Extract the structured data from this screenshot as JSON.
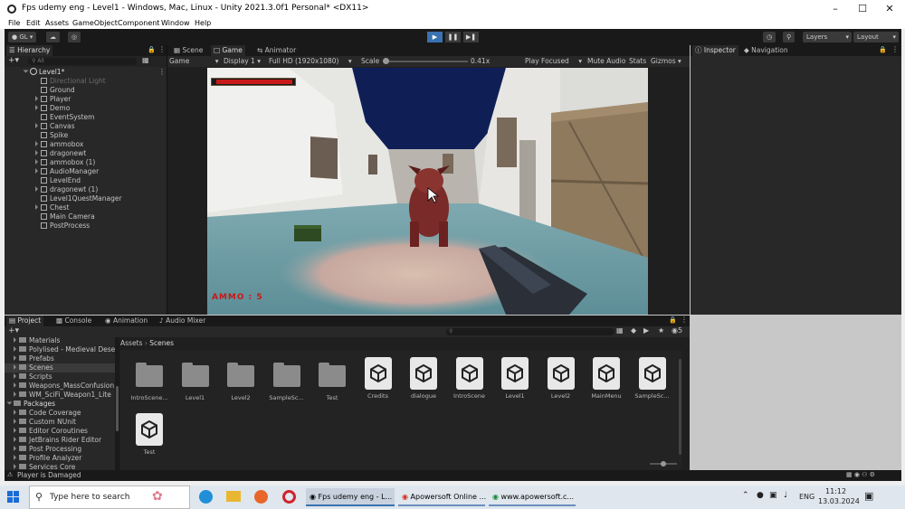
{
  "window": {
    "title": "Fps udemy eng - Level1 - Windows, Mac, Linux - Unity 2021.3.0f1 Personal* <DX11>"
  },
  "menu": [
    "File",
    "Edit",
    "Assets",
    "GameObject",
    "Component",
    "Window",
    "Help"
  ],
  "toolbar": {
    "account": "GL",
    "layers": "Layers",
    "layout": "Layout"
  },
  "hierarchy": {
    "tab": "Hierarchy",
    "search_placeholder": "All",
    "scene": "Level1*",
    "items": [
      {
        "label": "Directional Light",
        "dim": true,
        "arrow": false
      },
      {
        "label": "Ground",
        "arrow": false
      },
      {
        "label": "Player",
        "arrow": true
      },
      {
        "label": "Demo",
        "arrow": true
      },
      {
        "label": "EventSystem",
        "arrow": false
      },
      {
        "label": "Canvas",
        "arrow": true
      },
      {
        "label": "Spike",
        "arrow": false
      },
      {
        "label": "ammobox",
        "arrow": true
      },
      {
        "label": "dragonewt",
        "arrow": true
      },
      {
        "label": "ammobox (1)",
        "arrow": true
      },
      {
        "label": "AudioManager",
        "arrow": true
      },
      {
        "label": "LevelEnd",
        "arrow": false
      },
      {
        "label": "dragonewt (1)",
        "arrow": true
      },
      {
        "label": "Level1QuestManager",
        "arrow": false
      },
      {
        "label": "Chest",
        "arrow": true
      },
      {
        "label": "Main Camera",
        "arrow": false
      },
      {
        "label": "PostProcess",
        "arrow": false
      }
    ]
  },
  "center_tabs": {
    "scene": "Scene",
    "game": "Game",
    "animator": "Animator"
  },
  "game_bar": {
    "mode": "Game",
    "display": "Display 1",
    "resolution": "Full HD (1920x1080)",
    "scale_label": "Scale",
    "scale_value": "0.41x",
    "play_focused": "Play Focused",
    "mute": "Mute Audio",
    "stats": "Stats",
    "gizmos": "Gizmos"
  },
  "game_view": {
    "hud_text": "AMMO : 5",
    "health": 1.0
  },
  "right_tabs": {
    "inspector": "Inspector",
    "navigation": "Navigation"
  },
  "bottom_tabs": {
    "project": "Project",
    "console": "Console",
    "animation": "Animation",
    "audio_mixer": "Audio Mixer"
  },
  "project_tree": [
    {
      "label": "Materials",
      "indent": 1
    },
    {
      "label": "Polylised - Medieval Dese",
      "indent": 1
    },
    {
      "label": "Prefabs",
      "indent": 1
    },
    {
      "label": "Scenes",
      "indent": 1,
      "selected": true
    },
    {
      "label": "Scripts",
      "indent": 1
    },
    {
      "label": "Weapons_MassConfusion",
      "indent": 1
    },
    {
      "label": "WM_SciFi_Weapon1_Lite",
      "indent": 1
    },
    {
      "label": "Packages",
      "indent": 0,
      "bold": true
    },
    {
      "label": "Code Coverage",
      "indent": 1
    },
    {
      "label": "Custom NUnit",
      "indent": 1
    },
    {
      "label": "Editor Coroutines",
      "indent": 1
    },
    {
      "label": "JetBrains Rider Editor",
      "indent": 1
    },
    {
      "label": "Post Processing",
      "indent": 1
    },
    {
      "label": "Profile Analyzer",
      "indent": 1
    },
    {
      "label": "Services Core",
      "indent": 1
    }
  ],
  "breadcrumb": {
    "root": "Assets",
    "current": "Scenes"
  },
  "asset_count": "5",
  "assets": [
    {
      "label": "IntroScene...",
      "kind": "folder"
    },
    {
      "label": "Level1",
      "kind": "folder"
    },
    {
      "label": "Level2",
      "kind": "folder"
    },
    {
      "label": "SampleSc...",
      "kind": "folder"
    },
    {
      "label": "Test",
      "kind": "folder"
    },
    {
      "label": "Credits",
      "kind": "scene"
    },
    {
      "label": "dialogue",
      "kind": "scene"
    },
    {
      "label": "IntroScene",
      "kind": "scene"
    },
    {
      "label": "Level1",
      "kind": "scene"
    },
    {
      "label": "Level2",
      "kind": "scene"
    },
    {
      "label": "MainMenu",
      "kind": "scene"
    },
    {
      "label": "SampleSc...",
      "kind": "scene"
    },
    {
      "label": "Test",
      "kind": "scene"
    }
  ],
  "status": "Player is Damaged",
  "taskbar": {
    "search": "Type here to search",
    "apps": [
      "Fps udemy eng - L...",
      "Apowersoft Online ...",
      "www.apowersoft.c..."
    ],
    "lang": "ENG",
    "time": "11:12",
    "date": "13.03.2024"
  },
  "colors": {
    "accent": "#3a72b0",
    "hud_red": "#c81818",
    "editor_bg": "#282828"
  }
}
